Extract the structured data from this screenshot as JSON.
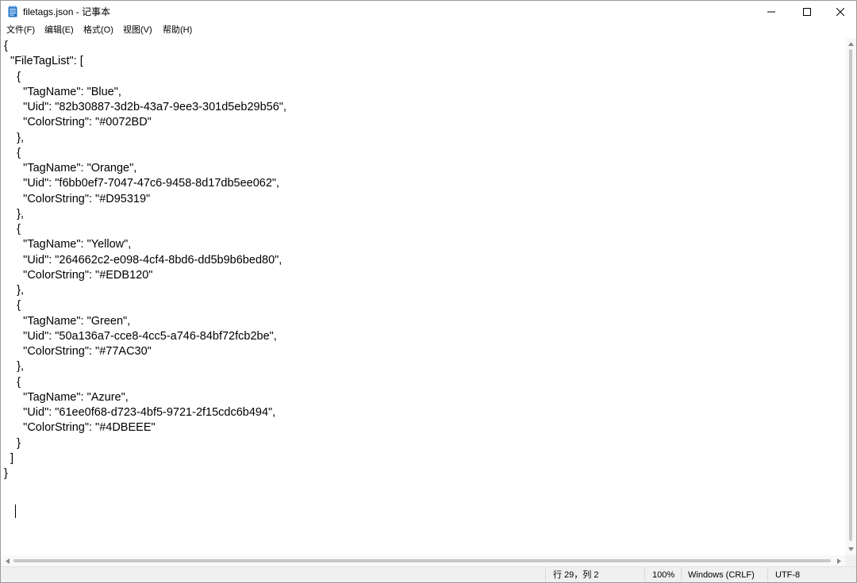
{
  "window": {
    "title": "filetags.json - 记事本",
    "app_icon": "notepad-icon",
    "controls": {
      "minimize_icon": "minimize-icon",
      "maximize_icon": "maximize-icon",
      "close_icon": "close-icon"
    }
  },
  "menu": {
    "items": [
      {
        "label": "文件(F)"
      },
      {
        "label": "编辑(E)"
      },
      {
        "label": "格式(O)"
      },
      {
        "label": "视图(V)"
      },
      {
        "label": "帮助(H)"
      }
    ]
  },
  "editor": {
    "lines": [
      "{",
      "  \"FileTagList\": [",
      "    {",
      "      \"TagName\": \"Blue\",",
      "      \"Uid\": \"82b30887-3d2b-43a7-9ee3-301d5eb29b56\",",
      "      \"ColorString\": \"#0072BD\"",
      "    },",
      "    {",
      "      \"TagName\": \"Orange\",",
      "      \"Uid\": \"f6bb0ef7-7047-47c6-9458-8d17db5ee062\",",
      "      \"ColorString\": \"#D95319\"",
      "    },",
      "    {",
      "      \"TagName\": \"Yellow\",",
      "      \"Uid\": \"264662c2-e098-4cf4-8bd6-dd5b9b6bed80\",",
      "      \"ColorString\": \"#EDB120\"",
      "    },",
      "    {",
      "      \"TagName\": \"Green\",",
      "      \"Uid\": \"50a136a7-cce8-4cc5-a746-84bf72fcb2be\",",
      "      \"ColorString\": \"#77AC30\"",
      "    },",
      "    {",
      "      \"TagName\": \"Azure\",",
      "      \"Uid\": \"61ee0f68-d723-4bf5-9721-2f15cdc6b494\",",
      "      \"ColorString\": \"#4DBEEE\"",
      "    }",
      "  ]",
      "}"
    ]
  },
  "status": {
    "position": "行 29，列 2",
    "zoom": "100%",
    "line_ending": "Windows (CRLF)",
    "encoding": "UTF-8"
  },
  "colors": {
    "window_border": "#9a9a9a",
    "statusbar_bg": "#f0f0f0",
    "scrollbar_thumb": "#c8c8c8",
    "icon_blue": "#1e73c9"
  }
}
